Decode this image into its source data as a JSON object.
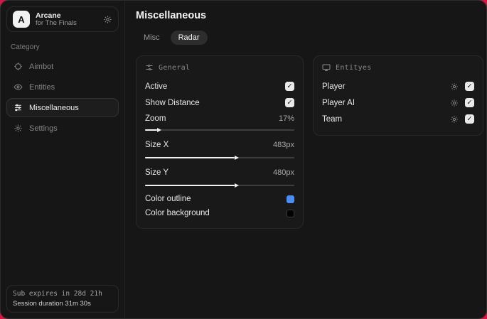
{
  "sidebar": {
    "app": {
      "initial": "A",
      "name": "Arcane",
      "subtitle": "for The Finals"
    },
    "category_label": "Category",
    "nav": [
      {
        "label": "Aimbot"
      },
      {
        "label": "Entities"
      },
      {
        "label": "Miscellaneous"
      },
      {
        "label": "Settings"
      }
    ],
    "footer": {
      "line1": "Sub expires in 28d 21h",
      "line2": "Session duration 31m 30s"
    }
  },
  "main": {
    "title": "Miscellaneous",
    "tabs": [
      {
        "label": "Misc",
        "active": false
      },
      {
        "label": "Radar",
        "active": true
      }
    ],
    "general_card": {
      "header": "General",
      "toggles": [
        {
          "label": "Active",
          "checked": true
        },
        {
          "label": "Show Distance",
          "checked": true
        }
      ],
      "sliders": [
        {
          "label": "Zoom",
          "value": "17%",
          "fill": "8%"
        },
        {
          "label": "Size X",
          "value": "483px",
          "fill": "60%"
        },
        {
          "label": "Size Y",
          "value": "480px",
          "fill": "60%"
        }
      ],
      "colors": [
        {
          "label": "Color outline",
          "hex": "#4c8cf5"
        },
        {
          "label": "Color background",
          "hex": "#000000"
        }
      ]
    },
    "entities_card": {
      "header": "Entityes",
      "rows": [
        {
          "label": "Player",
          "checked": true
        },
        {
          "label": "Player AI",
          "checked": true
        },
        {
          "label": "Team",
          "checked": true
        }
      ]
    }
  }
}
